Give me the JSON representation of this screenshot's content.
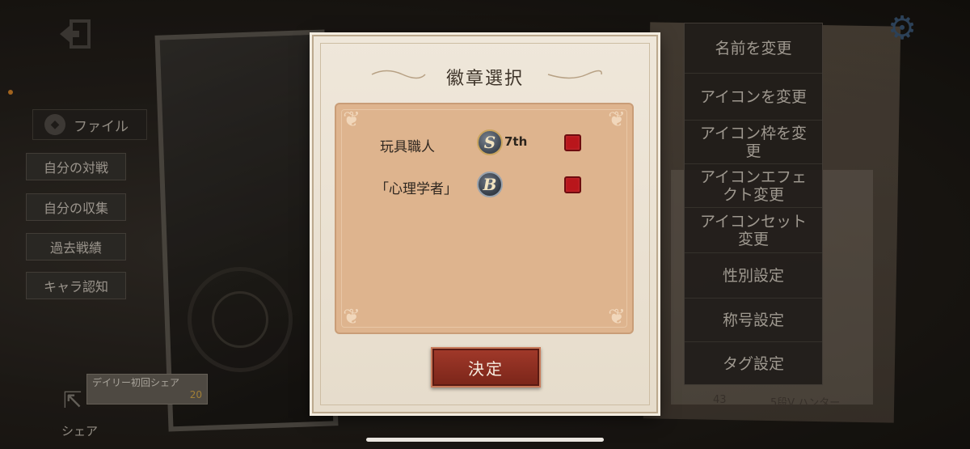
{
  "left_nav": {
    "file_tab": "ファイル",
    "buttons": [
      "自分の対戦",
      "自分の収集",
      "過去戦績",
      "キャラ認知"
    ],
    "share_card": {
      "text": "デイリー初回シェア",
      "reward": "20"
    },
    "share_label": "シェア"
  },
  "right_menu": {
    "items": [
      "名前を変更",
      "アイコンを変更",
      "アイコン枠を変更",
      "アイコンエフェクト変更",
      "アイコンセット変更",
      "性別設定",
      "称号設定",
      "タグ設定"
    ]
  },
  "right_info": {
    "rank": "5段Ⅴ ハンター",
    "num": "43"
  },
  "modal": {
    "title": "徽章選択",
    "badges": [
      {
        "name": "玩具職人",
        "icon_letter": "S",
        "rank": "7th"
      },
      {
        "name": "「心理学者」",
        "icon_letter": "B",
        "rank": ""
      }
    ],
    "confirm_label": "決定"
  },
  "colors": {
    "check_red": "#b9161b",
    "button_red": "#8f3022",
    "panel_tan": "#deb48e"
  }
}
